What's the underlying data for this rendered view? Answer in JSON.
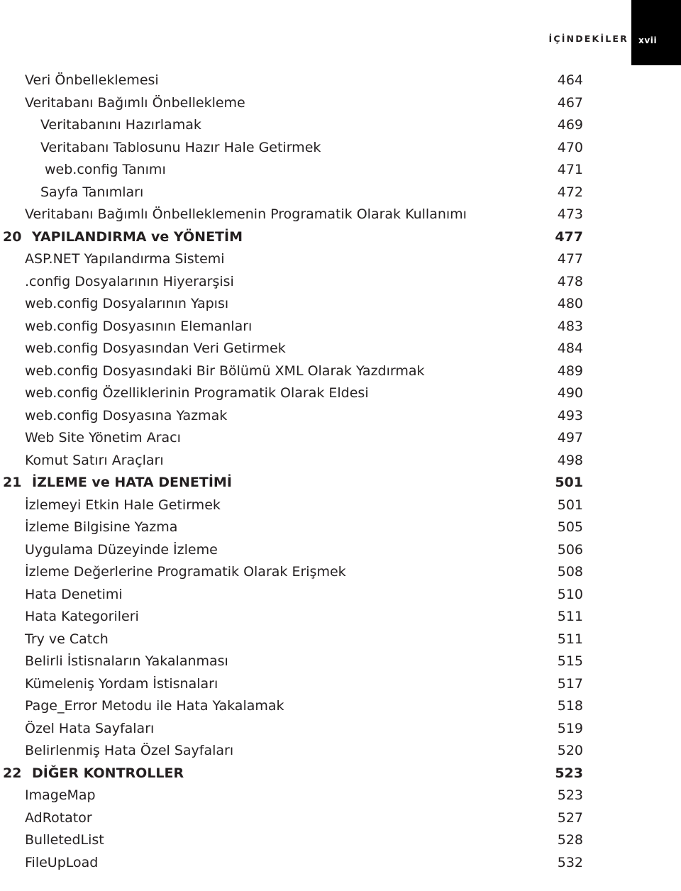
{
  "header": {
    "running_head": "İÇİNDEKİLER",
    "folio": "xvii",
    "folio_box_color": "#000000"
  },
  "toc": {
    "rows": [
      {
        "level": 1,
        "chapter": "",
        "title": "Veri Önbelleklemesi",
        "page": "464",
        "bold": false
      },
      {
        "level": 1,
        "chapter": "",
        "title": "Veritabanı Bağımlı Önbellekleme",
        "page": "467",
        "bold": false
      },
      {
        "level": 2,
        "chapter": "",
        "title": "Veritabanını Hazırlamak",
        "page": "469",
        "bold": false
      },
      {
        "level": 2,
        "chapter": "",
        "title": "Veritabanı Tablosunu Hazır Hale Getirmek",
        "page": "470",
        "bold": false
      },
      {
        "level": 3,
        "chapter": "",
        "title": "web.config Tanımı",
        "page": "471",
        "bold": false
      },
      {
        "level": 2,
        "chapter": "",
        "title": "Sayfa Tanımları",
        "page": "472",
        "bold": false
      },
      {
        "level": 1,
        "chapter": "",
        "title": "Veritabanı Bağımlı Önbelleklemenin Programatik Olarak Kullanımı",
        "page": "473",
        "bold": false
      },
      {
        "level": 0,
        "chapter": "20",
        "title": "YAPILANDIRMA ve YÖNETİM",
        "page": "477",
        "bold": true
      },
      {
        "level": 1,
        "chapter": "",
        "title": "ASP.NET Yapılandırma Sistemi",
        "page": "477",
        "bold": false
      },
      {
        "level": 1,
        "chapter": "",
        "title": ".config Dosyalarının Hiyerarşisi",
        "page": "478",
        "bold": false
      },
      {
        "level": 1,
        "chapter": "",
        "title": "web.config Dosyalarının Yapısı",
        "page": "480",
        "bold": false
      },
      {
        "level": 1,
        "chapter": "",
        "title": "web.config Dosyasının Elemanları",
        "page": "483",
        "bold": false
      },
      {
        "level": 1,
        "chapter": "",
        "title": "web.config Dosyasından Veri Getirmek",
        "page": "484",
        "bold": false
      },
      {
        "level": 1,
        "chapter": "",
        "title": "web.config Dosyasındaki Bir Bölümü XML Olarak Yazdırmak",
        "page": "489",
        "bold": false
      },
      {
        "level": 1,
        "chapter": "",
        "title": "web.config Özelliklerinin Programatik Olarak Eldesi",
        "page": "490",
        "bold": false
      },
      {
        "level": 1,
        "chapter": "",
        "title": "web.config Dosyasına Yazmak",
        "page": "493",
        "bold": false
      },
      {
        "level": 1,
        "chapter": "",
        "title": "Web Site Yönetim Aracı",
        "page": "497",
        "bold": false
      },
      {
        "level": 1,
        "chapter": "",
        "title": "Komut Satırı Araçları",
        "page": "498",
        "bold": false
      },
      {
        "level": 0,
        "chapter": "21",
        "title": "İZLEME ve HATA DENETİMİ",
        "page": "501",
        "bold": true
      },
      {
        "level": 1,
        "chapter": "",
        "title": "İzlemeyi Etkin Hale Getirmek",
        "page": "501",
        "bold": false
      },
      {
        "level": 1,
        "chapter": "",
        "title": "İzleme Bilgisine Yazma",
        "page": "505",
        "bold": false
      },
      {
        "level": 1,
        "chapter": "",
        "title": "Uygulama Düzeyinde İzleme",
        "page": "506",
        "bold": false
      },
      {
        "level": 1,
        "chapter": "",
        "title": "İzleme Değerlerine Programatik Olarak Erişmek",
        "page": "508",
        "bold": false
      },
      {
        "level": 1,
        "chapter": "",
        "title": "Hata Denetimi",
        "page": "510",
        "bold": false
      },
      {
        "level": 1,
        "chapter": "",
        "title": "Hata Kategorileri",
        "page": "511",
        "bold": false
      },
      {
        "level": 1,
        "chapter": "",
        "title": "Try ve Catch",
        "page": "511",
        "bold": false
      },
      {
        "level": 1,
        "chapter": "",
        "title": "Belirli İstisnaların Yakalanması",
        "page": "515",
        "bold": false
      },
      {
        "level": 1,
        "chapter": "",
        "title": "Kümeleniş Yordam İstisnaları",
        "page": "517",
        "bold": false
      },
      {
        "level": 1,
        "chapter": "",
        "title": "Page_Error Metodu ile Hata Yakalamak",
        "page": "518",
        "bold": false
      },
      {
        "level": 1,
        "chapter": "",
        "title": "Özel Hata Sayfaları",
        "page": "519",
        "bold": false
      },
      {
        "level": 1,
        "chapter": "",
        "title": "Belirlenmiş Hata Özel Sayfaları",
        "page": "520",
        "bold": false
      },
      {
        "level": 0,
        "chapter": "22",
        "title": "DİĞER KONTROLLER",
        "page": "523",
        "bold": true
      },
      {
        "level": 1,
        "chapter": "",
        "title": "ImageMap",
        "page": "523",
        "bold": false
      },
      {
        "level": 1,
        "chapter": "",
        "title": "AdRotator",
        "page": "527",
        "bold": false
      },
      {
        "level": 1,
        "chapter": "",
        "title": "BulletedList",
        "page": "528",
        "bold": false
      },
      {
        "level": 1,
        "chapter": "",
        "title": "FileUpLoad",
        "page": "532",
        "bold": false
      }
    ]
  }
}
